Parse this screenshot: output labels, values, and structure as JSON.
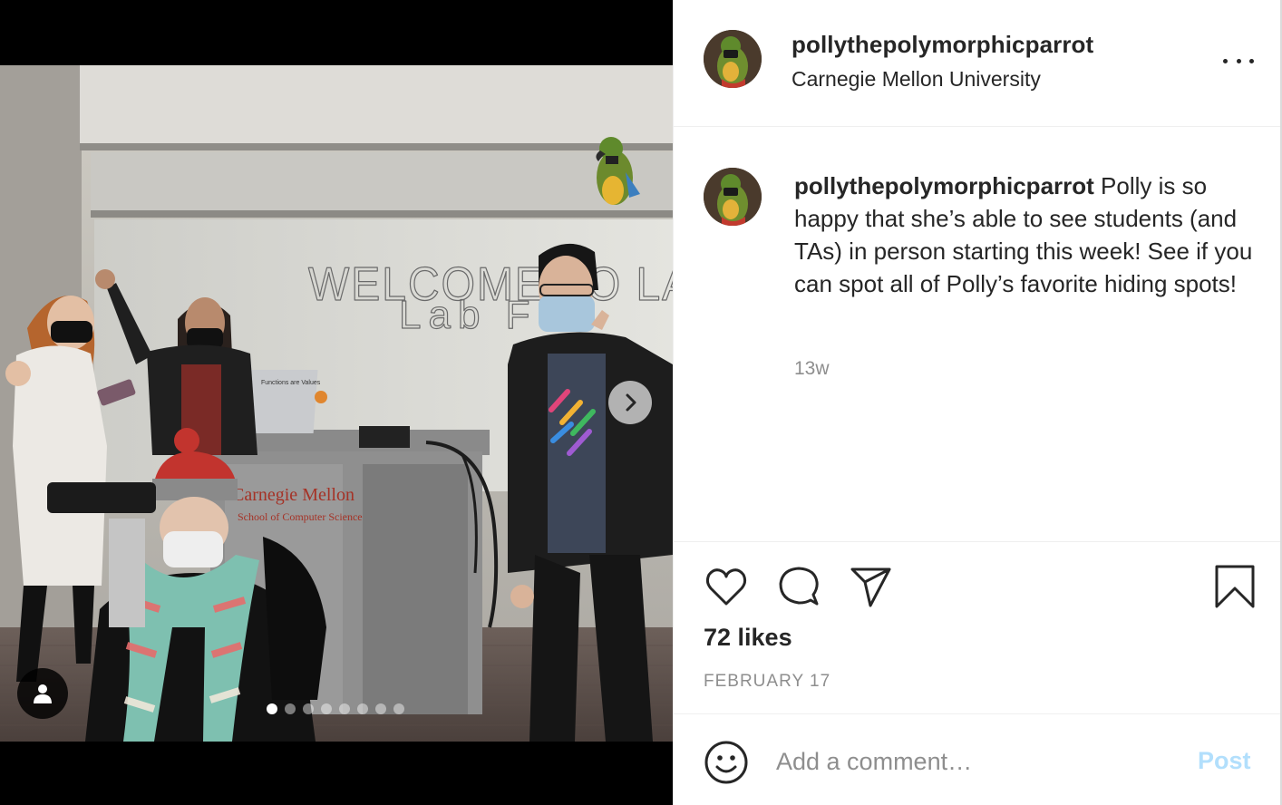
{
  "post": {
    "username": "pollythepolymorphicparrot",
    "location": "Carnegie Mellon University",
    "photo_text": {
      "board_line1": "WELCOME TO LAB",
      "board_line2": "Lab F",
      "podium_line1": "Carnegie Mellon",
      "podium_line2": "School of Computer Science",
      "laptop_sticker": "Functions are Values"
    },
    "carousel": {
      "total_images": 8,
      "current_index": 1
    },
    "caption": {
      "username": "pollythepolymorphicparrot",
      "text": "Polly is so happy that she’s able to see students (and TAs) in person starting this week! See if you can spot all of Polly’s favorite hiding spots!"
    },
    "time_ago": "13w",
    "likes": "72 likes",
    "date": "FEBRUARY 17"
  },
  "icons": {
    "like": "heart-icon",
    "comment": "speech-bubble-icon",
    "share": "paper-plane-icon",
    "save": "bookmark-icon",
    "more": "more-horizontal-icon",
    "next": "chevron-right-icon",
    "tag": "user-tag-icon",
    "emoji": "smiley-icon"
  },
  "comment_box": {
    "placeholder": "Add a comment…",
    "post_label": "Post"
  },
  "colors": {
    "text": "#262626",
    "muted": "#8e8e8e",
    "post_disabled": "#b2dffc",
    "border": "#efefef"
  }
}
